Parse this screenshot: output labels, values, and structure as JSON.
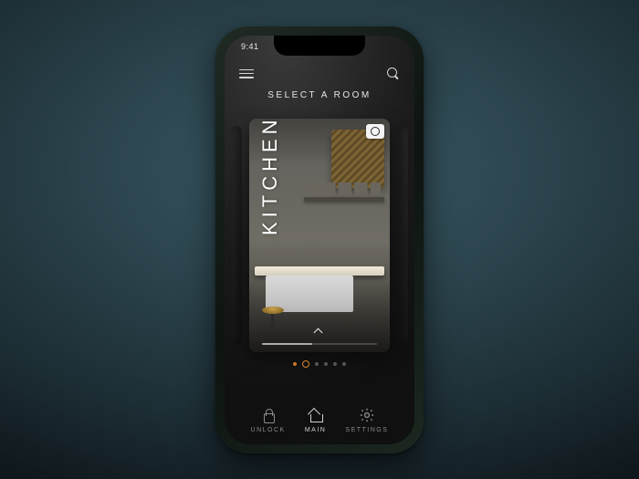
{
  "status": {
    "time": "9:41"
  },
  "header": {
    "title": "SELECT A ROOM"
  },
  "room": {
    "current_label": "KITCHEN",
    "index": 1,
    "count": 6
  },
  "icons": {
    "menu": "menu-icon",
    "search": "search-icon",
    "camera": "camera-icon",
    "chevron_up": "chevron-up-icon"
  },
  "nav": {
    "items": [
      {
        "id": "unlock",
        "label": "UNLOCK",
        "icon": "lock-icon",
        "active": false
      },
      {
        "id": "main",
        "label": "MAIN",
        "icon": "home-icon",
        "active": true
      },
      {
        "id": "settings",
        "label": "SETTINGS",
        "icon": "gear-icon",
        "active": false
      }
    ]
  },
  "colors": {
    "accent": "#d8842f",
    "text": "#e8e8e8",
    "muted": "#8a8a8a"
  }
}
